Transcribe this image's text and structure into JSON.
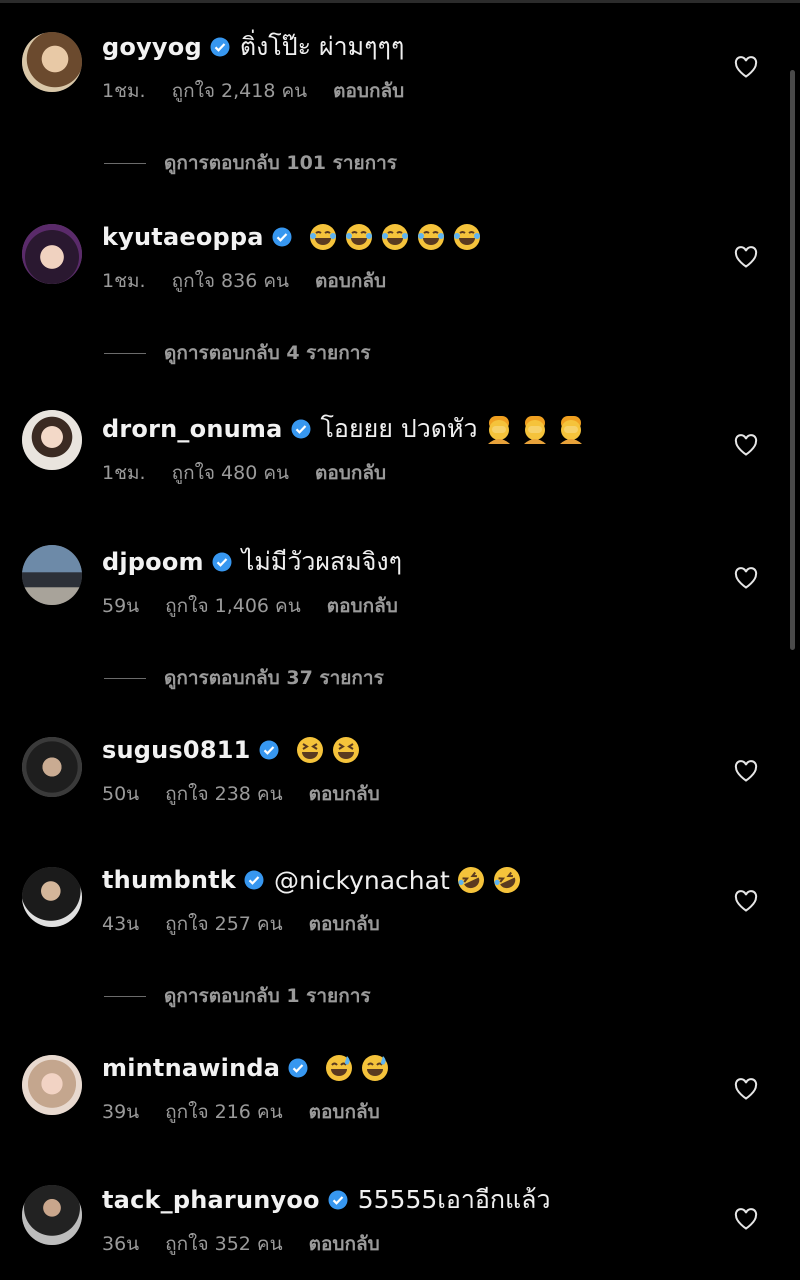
{
  "colors": {
    "background": "#000000",
    "verified": "#3797f0",
    "meta": "#9a9a9a"
  },
  "comments": [
    {
      "username": "goyyog",
      "text": "ติ่งโป๊ะ ผ่ามๆๆๆ",
      "emojis": [],
      "time": "1ชม.",
      "likes": "ถูกใจ 2,418 คน",
      "reply": "ตอบกลับ",
      "view_replies": "ดูการตอบกลับ 101 รายการ"
    },
    {
      "username": "kyutaeoppa",
      "text": "",
      "emojis": [
        "tears-of-joy",
        "tears-of-joy",
        "tears-of-joy",
        "tears-of-joy",
        "tears-of-joy"
      ],
      "time": "1ชม.",
      "likes": "ถูกใจ 836 คน",
      "reply": "ตอบกลับ",
      "view_replies": "ดูการตอบกลับ 4 รายการ"
    },
    {
      "username": "drorn_onuma",
      "text": "โอยยย ปวดหัว",
      "emojis": [
        "facepalm",
        "facepalm",
        "facepalm"
      ],
      "time": "1ชม.",
      "likes": "ถูกใจ 480 คน",
      "reply": "ตอบกลับ",
      "view_replies": ""
    },
    {
      "username": "djpoom",
      "text": "ไม่มีวัวผสมจิงๆ",
      "emojis": [],
      "time": "59น",
      "likes": "ถูกใจ 1,406 คน",
      "reply": "ตอบกลับ",
      "view_replies": "ดูการตอบกลับ 37 รายการ"
    },
    {
      "username": "sugus0811",
      "text": "",
      "emojis": [
        "grinning-squint",
        "grinning-squint"
      ],
      "time": "50น",
      "likes": "ถูกใจ 238 คน",
      "reply": "ตอบกลับ",
      "view_replies": ""
    },
    {
      "username": "thumbntk",
      "text": "@nickynachat",
      "emojis": [
        "rofl",
        "rofl"
      ],
      "time": "43น",
      "likes": "ถูกใจ 257 คน",
      "reply": "ตอบกลับ",
      "view_replies": "ดูการตอบกลับ 1 รายการ"
    },
    {
      "username": "mintnawinda",
      "text": "",
      "emojis": [
        "grin-sweat",
        "grin-sweat"
      ],
      "time": "39น",
      "likes": "ถูกใจ 216 คน",
      "reply": "ตอบกลับ",
      "view_replies": ""
    },
    {
      "username": "tack_pharunyoo",
      "text": "55555เอาอีกแล้ว",
      "emojis": [],
      "time": "36น",
      "likes": "ถูกใจ 352 คน",
      "reply": "ตอบกลับ",
      "view_replies": ""
    }
  ]
}
